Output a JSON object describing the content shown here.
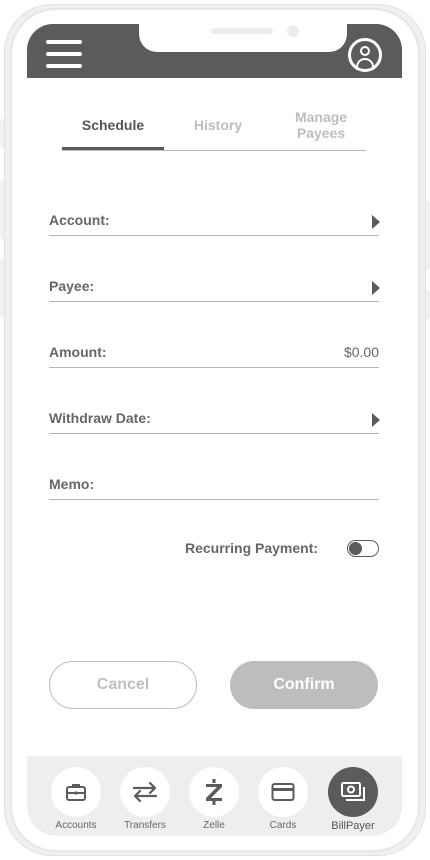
{
  "tabs": {
    "schedule": "Schedule",
    "history": "History",
    "manage_payees": "Manage Payees"
  },
  "form": {
    "account_label": "Account:",
    "payee_label": "Payee:",
    "amount_label": "Amount:",
    "amount_value": "$0.00",
    "withdraw_date_label": "Withdraw Date:",
    "memo_label": "Memo:",
    "recurring_label": "Recurring Payment:",
    "recurring_enabled": false
  },
  "actions": {
    "cancel": "Cancel",
    "confirm": "Confirm"
  },
  "bottom_nav": {
    "accounts": "Accounts",
    "transfers": "Transfers",
    "zelle": "Zelle",
    "cards": "Cards",
    "billpayer": "BillPayer",
    "active": "billpayer"
  },
  "colors": {
    "primary_dark": "#5b5b5b",
    "inactive": "#bdbdbd"
  }
}
